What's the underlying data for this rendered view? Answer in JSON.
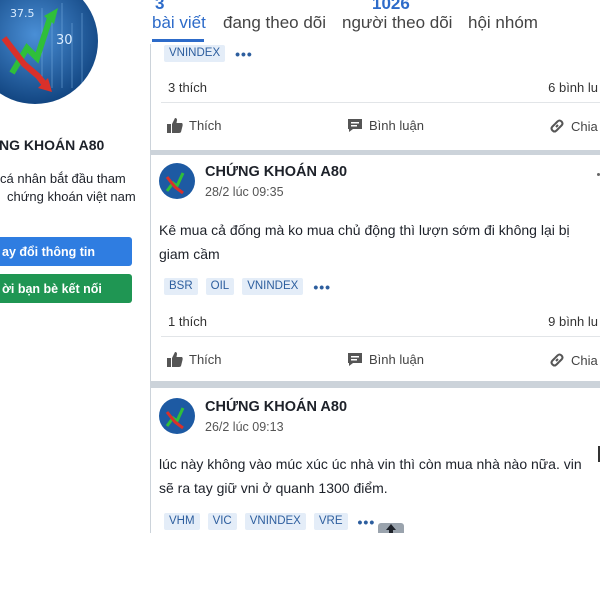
{
  "profile": {
    "name": "NG KHOÁN A80",
    "bio_line1": "cá nhân bắt đầu tham",
    "bio_line2": "chứng khoán việt nam",
    "edit_button": "ay đổi thông tin",
    "invite_button": "ời bạn bè kết nối",
    "avatar_numbers": [
      "37.5",
      "30"
    ]
  },
  "tabs": {
    "items": [
      "bài viết",
      "đang theo dõi",
      "người theo dõi",
      "hội nhóm"
    ],
    "active_index": 0,
    "stats_cut": [
      "3",
      "1026"
    ]
  },
  "actions": {
    "like": "Thích",
    "comment": "Bình luận",
    "share": "Chia"
  },
  "posts": [
    {
      "tags": [
        "VNINDEX"
      ],
      "likes": "3 thích",
      "comments": "6 bình lu"
    },
    {
      "author": "CHỨNG KHOÁN A80",
      "time": "28/2 lúc 09:35",
      "text_line1": "Kê mua cả đống mà ko mua chủ động thì lượn sớm đi không lại bị",
      "text_line2": "giam cầm",
      "tags": [
        "BSR",
        "OIL",
        "VNINDEX"
      ],
      "likes": "1 thích",
      "comments": "9 bình lu"
    },
    {
      "author": "CHỨNG KHOÁN A80",
      "time": "26/2 lúc 09:13",
      "text_line1": "lúc này không vào múc xúc úc nhà vin thì còn mua nhà nào nữa. vin",
      "text_line2": "sẽ ra tay giữ vni ở quanh 1300 điểm.",
      "tags": [
        "VHM",
        "VIC",
        "VNINDEX",
        "VRE"
      ]
    }
  ],
  "more_tags_label": "•••",
  "colors": {
    "accent": "#2d6bc9",
    "edit_button": "#2f7de1",
    "invite_button": "#1f9653"
  }
}
